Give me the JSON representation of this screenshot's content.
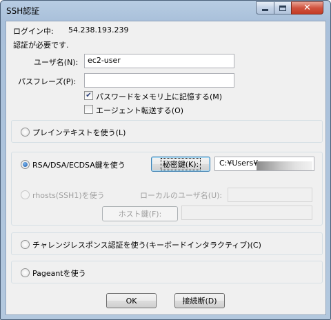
{
  "window": {
    "title": "SSH認証"
  },
  "login": {
    "label": "ログイン中:",
    "host": "54.238.193.239"
  },
  "auth_required": "認証が必要です.",
  "username": {
    "label": "ユーザ名(N):",
    "value": "ec2-user"
  },
  "passphrase": {
    "label": "パスフレーズ(P):",
    "value": ""
  },
  "remember_password": {
    "label": "パスワードをメモリ上に記憶する(M)",
    "checked": true
  },
  "agent_forward": {
    "label": "エージェント転送する(O)",
    "checked": false
  },
  "auth_methods": {
    "plaintext": {
      "label": "プレインテキストを使う(L)",
      "selected": false
    },
    "rsa": {
      "label": "RSA/DSA/ECDSA鍵を使う",
      "selected": true,
      "key_button": "秘密鍵(K):",
      "key_path": "C:¥Users¥"
    },
    "rhosts": {
      "label": "rhosts(SSH1)を使う",
      "local_user_label": "ローカルのユーザ名(U):",
      "host_key_button": "ホスト鍵(F):",
      "enabled": false
    },
    "challenge": {
      "label": "チャレンジレスポンス認証を使う(キーボードインタラクティブ)(C)",
      "selected": false
    },
    "pageant": {
      "label": "Pageantを使う",
      "selected": false
    }
  },
  "buttons": {
    "ok": "OK",
    "disconnect": "接続断(D)"
  },
  "colors": {
    "title_bar": "#b8cde3",
    "close_button": "#c33c25",
    "dialog_bg": "#f0f0f0"
  }
}
